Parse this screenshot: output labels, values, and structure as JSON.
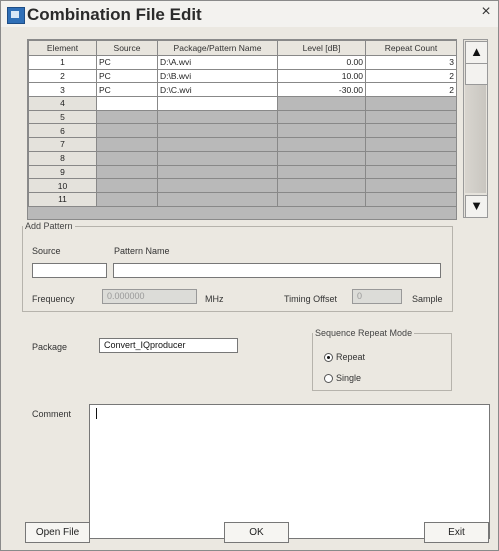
{
  "window": {
    "title": "Combination File Edit",
    "close": "×"
  },
  "table": {
    "headers": [
      "Element",
      "Source",
      "Package/Pattern Name",
      "Level [dB]",
      "Repeat Count"
    ],
    "rows": [
      {
        "element": "1",
        "source": "PC",
        "name": "D:\\A.wvi",
        "level": "0.00",
        "repeat": "3"
      },
      {
        "element": "2",
        "source": "PC",
        "name": "D:\\B.wvi",
        "level": "10.00",
        "repeat": "2"
      },
      {
        "element": "3",
        "source": "PC",
        "name": "D:\\C.wvi",
        "level": "-30.00",
        "repeat": "2"
      },
      {
        "element": "4",
        "source": "",
        "name": "",
        "level": "",
        "repeat": ""
      },
      {
        "element": "5",
        "source": "",
        "name": "",
        "level": "",
        "repeat": ""
      },
      {
        "element": "6",
        "source": "",
        "name": "",
        "level": "",
        "repeat": ""
      },
      {
        "element": "7",
        "source": "",
        "name": "",
        "level": "",
        "repeat": ""
      },
      {
        "element": "8",
        "source": "",
        "name": "",
        "level": "",
        "repeat": ""
      },
      {
        "element": "9",
        "source": "",
        "name": "",
        "level": "",
        "repeat": ""
      },
      {
        "element": "10",
        "source": "",
        "name": "",
        "level": "",
        "repeat": ""
      },
      {
        "element": "11",
        "source": "",
        "name": "",
        "level": "",
        "repeat": ""
      }
    ]
  },
  "scroll": {
    "up": "▲",
    "down": "▼"
  },
  "add_pattern": {
    "legend": "Add Pattern",
    "source_label": "Source",
    "pattern_name_label": "Pattern Name",
    "source_value": "",
    "pattern_name_value": "",
    "frequency_label": "Frequency",
    "frequency_value": "0.000000",
    "frequency_unit": "MHz",
    "timing_offset_label": "Timing Offset",
    "timing_offset_value": "0",
    "timing_offset_unit": "Sample"
  },
  "package": {
    "label": "Package",
    "value": "Convert_IQproducer"
  },
  "repeat_mode": {
    "legend": "Sequence Repeat Mode",
    "options": [
      "Repeat",
      "Single"
    ],
    "selected": "Repeat"
  },
  "comment": {
    "label": "Comment",
    "value": ""
  },
  "buttons": {
    "open_file": "Open File",
    "ok": "OK",
    "exit": "Exit"
  }
}
